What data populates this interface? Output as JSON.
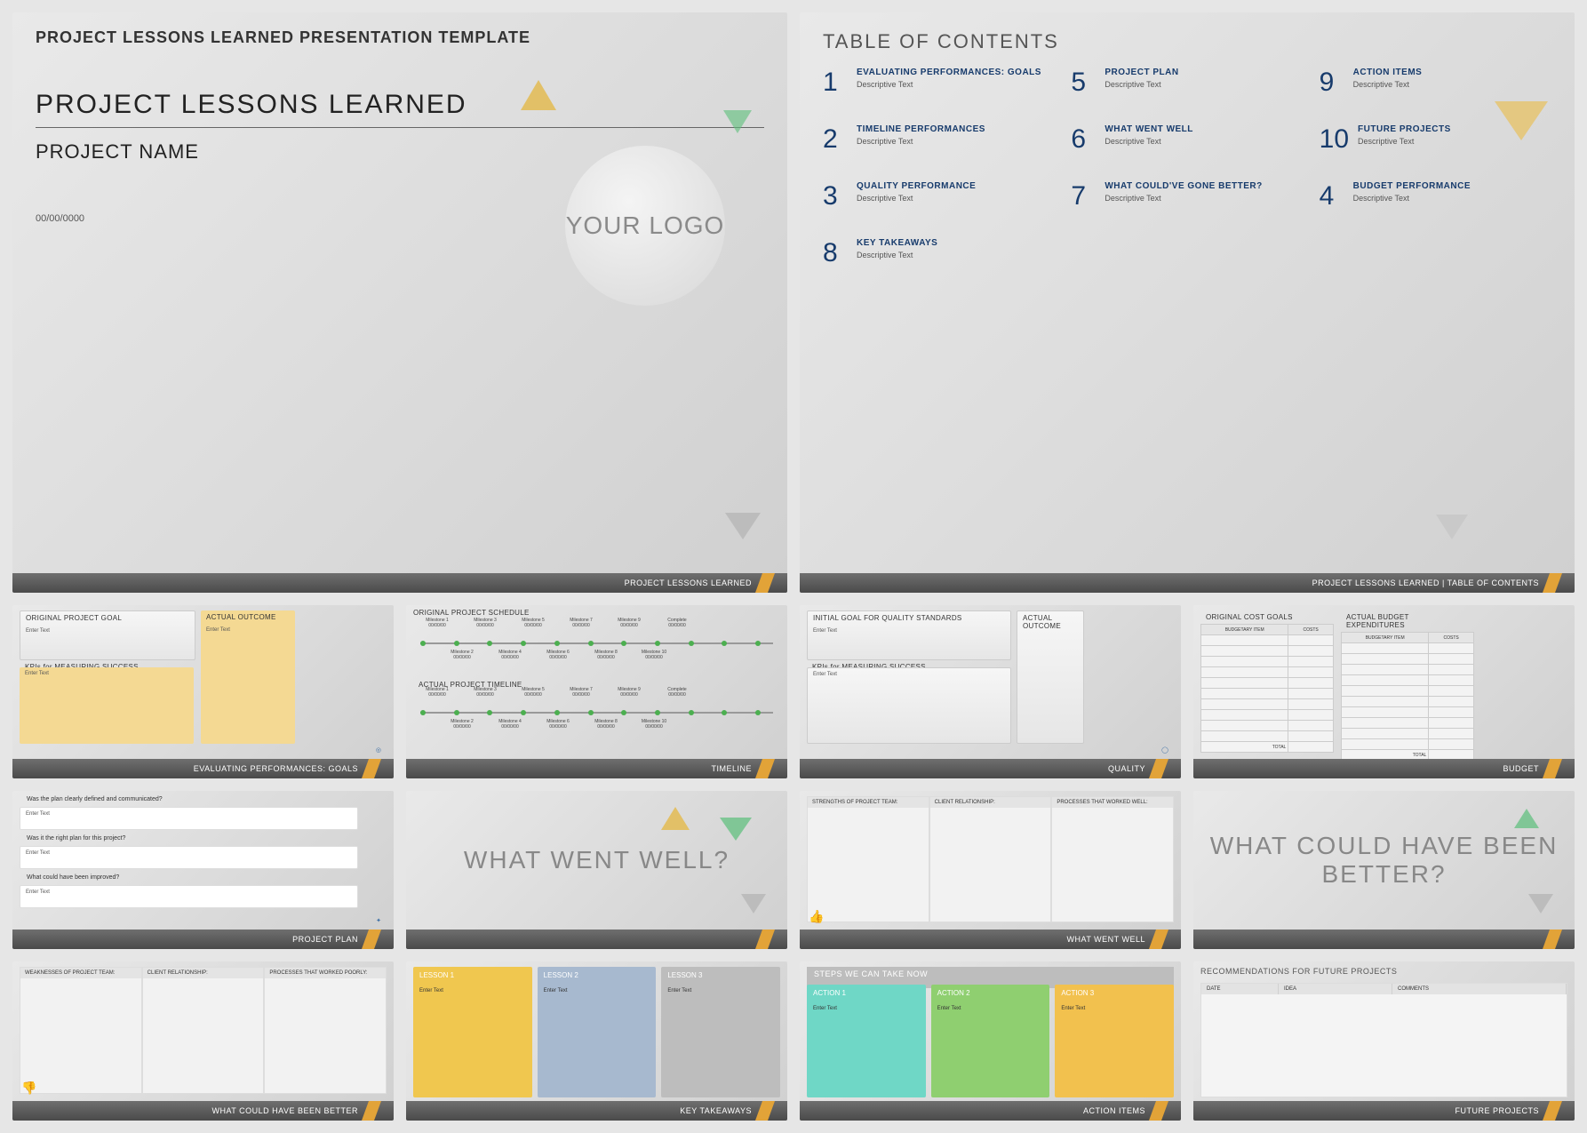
{
  "colors": {
    "navy": "#173b6c",
    "amber": "#e2a338",
    "slate": "#6f6f6f"
  },
  "slide1": {
    "header": "PROJECT LESSONS LEARNED PRESENTATION TEMPLATE",
    "title": "PROJECT LESSONS LEARNED",
    "subtitle": "PROJECT NAME",
    "date": "00/00/0000",
    "logo": "YOUR LOGO",
    "footer": "PROJECT LESSONS LEARNED"
  },
  "slide2": {
    "title": "TABLE OF CONTENTS",
    "items": [
      {
        "n": "1",
        "label": "EVALUATING PERFORMANCES: GOALS",
        "desc": "Descriptive Text"
      },
      {
        "n": "5",
        "label": "PROJECT PLAN",
        "desc": "Descriptive Text"
      },
      {
        "n": "9",
        "label": "ACTION ITEMS",
        "desc": "Descriptive Text"
      },
      {
        "n": "2",
        "label": "TIMELINE PERFORMANCES",
        "desc": "Descriptive Text"
      },
      {
        "n": "6",
        "label": "WHAT WENT WELL",
        "desc": "Descriptive Text"
      },
      {
        "n": "10",
        "label": "FUTURE PROJECTS",
        "desc": "Descriptive Text"
      },
      {
        "n": "3",
        "label": "QUALITY PERFORMANCE",
        "desc": "Descriptive Text"
      },
      {
        "n": "7",
        "label": "WHAT COULD'VE GONE BETTER?",
        "desc": "Descriptive Text"
      },
      {
        "n": "4",
        "label": "BUDGET PERFORMANCE",
        "desc": "Descriptive Text"
      },
      {
        "n": "8",
        "label": "KEY TAKEAWAYS",
        "desc": "Descriptive Text"
      }
    ],
    "footer": "PROJECT LESSONS LEARNED   |   TABLE OF CONTENTS"
  },
  "slide3": {
    "h1": "ORIGINAL PROJECT GOAL",
    "h2": "ACTUAL OUTCOME",
    "h3": "KPIs for MEASURING SUCCESS",
    "enter": "Enter Text",
    "footer": "EVALUATING PERFORMANCES: GOALS"
  },
  "slide4": {
    "h1": "ORIGINAL PROJECT SCHEDULE",
    "h2": "ACTUAL PROJECT TIMELINE",
    "ms_top": [
      "Milestone 1",
      "Milestone 3",
      "Milestone 5",
      "Milestone 7",
      "Milestone 9",
      "Complete"
    ],
    "ms_bot": [
      "Milestone 2",
      "Milestone 4",
      "Milestone 6",
      "Milestone 8",
      "Milestone 10"
    ],
    "date": "00/00/00",
    "footer": "TIMELINE"
  },
  "slide5": {
    "h1": "INITIAL GOAL FOR QUALITY STANDARDS",
    "h2": "ACTUAL OUTCOME",
    "h3": "KPIs for MEASURING SUCCESS",
    "enter": "Enter Text",
    "footer": "QUALITY"
  },
  "slide6": {
    "h1": "ORIGINAL COST GOALS",
    "h2": "ACTUAL BUDGET EXPENDITURES",
    "col1": "BUDGETARY ITEM",
    "col2": "COSTS",
    "total": "TOTAL",
    "footer": "BUDGET"
  },
  "slide7": {
    "q1": "Was the plan clearly defined and communicated?",
    "q2": "Was it the right plan for this project?",
    "q3": "What could have been improved?",
    "enter": "Enter Text",
    "footer": "PROJECT PLAN"
  },
  "slide8": {
    "title": "WHAT WENT WELL?",
    "footer": ""
  },
  "slide9": {
    "c1": "STRENGTHS OF PROJECT TEAM:",
    "c2": "CLIENT RELATIONSHIP:",
    "c3": "PROCESSES THAT WORKED WELL:",
    "footer": "WHAT WENT WELL"
  },
  "slide10": {
    "title": "WHAT COULD HAVE BEEN BETTER?",
    "footer": ""
  },
  "slide11": {
    "c1": "WEAKNESSES OF PROJECT TEAM:",
    "c2": "CLIENT RELATIONSHIP:",
    "c3": "PROCESSES THAT WORKED POORLY:",
    "footer": "WHAT COULD HAVE BEEN BETTER"
  },
  "slide12": {
    "lessons": [
      {
        "h": "LESSON 1",
        "color": "#f0c74f"
      },
      {
        "h": "LESSON 2",
        "color": "#a7b9cf"
      },
      {
        "h": "LESSON 3",
        "color": "#bdbdbd"
      }
    ],
    "enter": "Enter Text",
    "footer": "KEY TAKEAWAYS"
  },
  "slide13": {
    "title": "STEPS WE CAN TAKE NOW",
    "actions": [
      {
        "h": "ACTION 1",
        "color": "#6fd7c6"
      },
      {
        "h": "ACTION 2",
        "color": "#8fcf70"
      },
      {
        "h": "ACTION 3",
        "color": "#f2c14e"
      }
    ],
    "enter": "Enter Text",
    "footer": "ACTION ITEMS"
  },
  "slide14": {
    "title": "RECOMMENDATIONS FOR FUTURE PROJECTS",
    "cols": [
      "DATE",
      "IDEA",
      "COMMENTS"
    ],
    "footer": "FUTURE PROJECTS"
  }
}
